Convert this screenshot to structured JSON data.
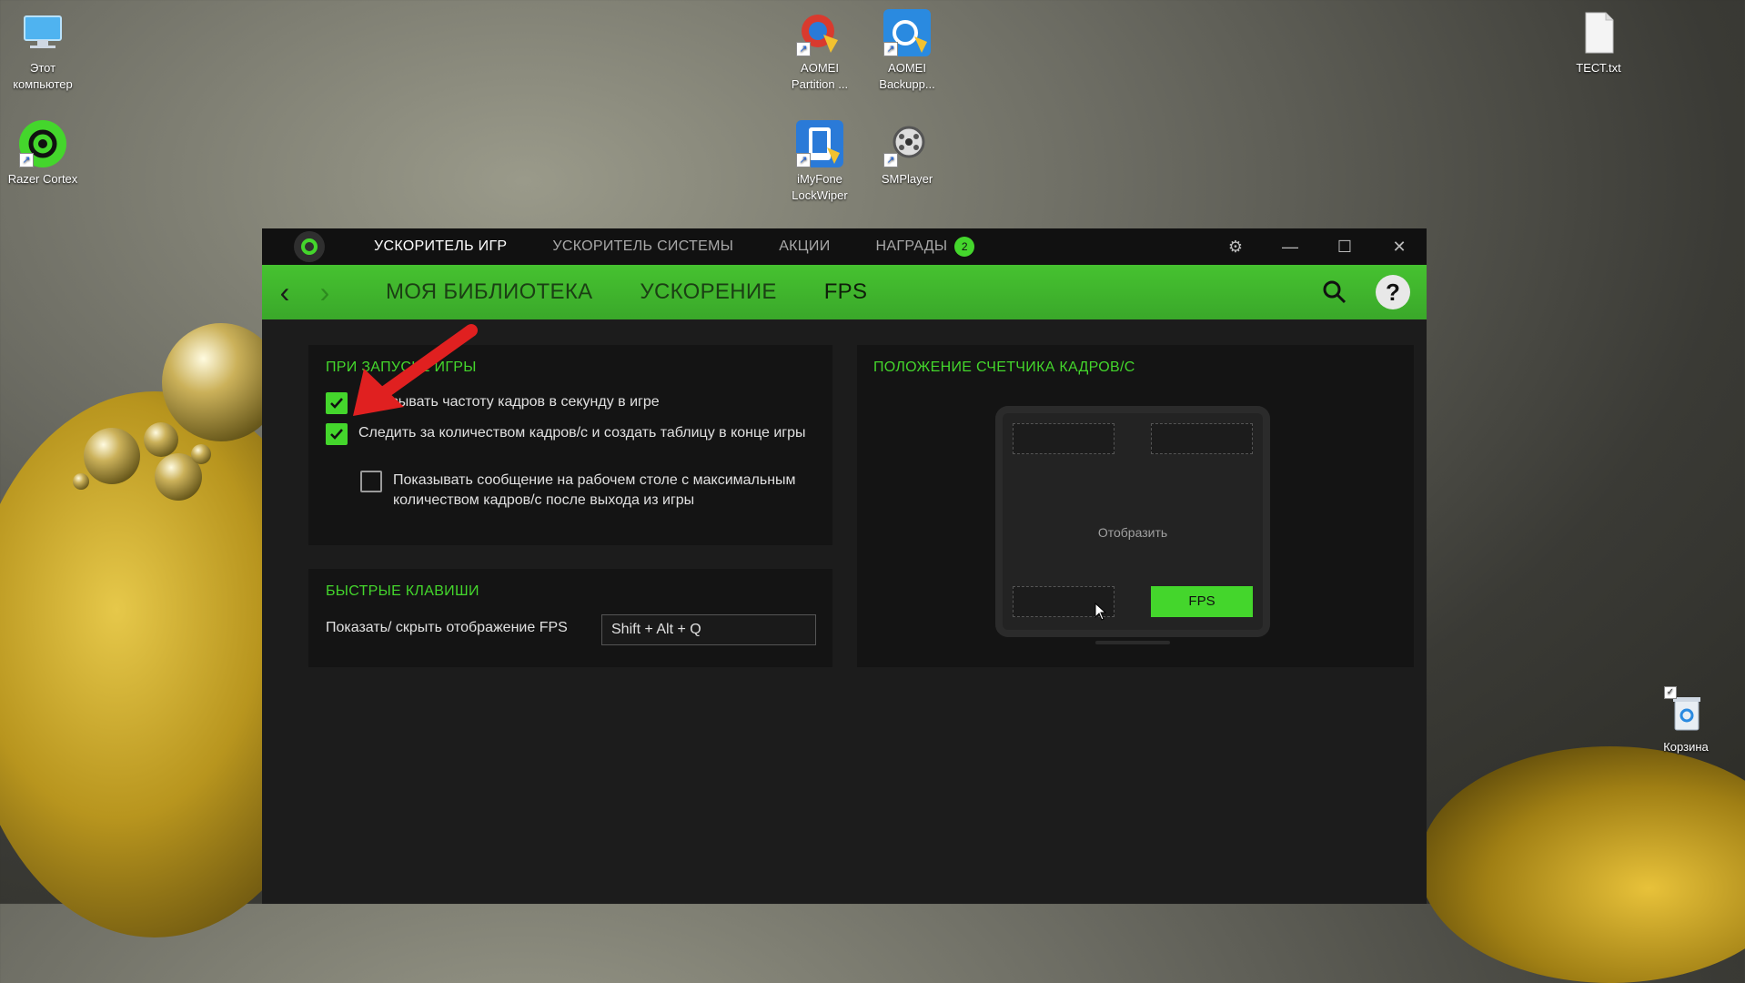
{
  "desktop": {
    "icons": [
      {
        "label_line1": "Этот",
        "label_line2": "компьютер",
        "icon": "computer-icon"
      },
      {
        "label_line1": "Razer Cortex",
        "label_line2": "",
        "icon": "razer-cortex-icon"
      },
      {
        "label_line1": "AOMEI",
        "label_line2": "Partition ...",
        "icon": "aomei-partition-icon"
      },
      {
        "label_line1": "AOMEI",
        "label_line2": "Backupp...",
        "icon": "aomei-backupper-icon"
      },
      {
        "label_line1": "iMyFone",
        "label_line2": "LockWiper",
        "icon": "imyfone-icon"
      },
      {
        "label_line1": "SMPlayer",
        "label_line2": "",
        "icon": "smplayer-icon"
      },
      {
        "label_line1": "ТЕСТ.txt",
        "label_line2": "",
        "icon": "text-file-icon"
      },
      {
        "label_line1": "Корзина",
        "label_line2": "",
        "icon": "recycle-bin-icon"
      }
    ]
  },
  "app": {
    "top_tabs": [
      {
        "label": "УСКОРИТЕЛЬ ИГР",
        "active": true
      },
      {
        "label": "УСКОРИТЕЛЬ СИСТЕМЫ",
        "active": false
      },
      {
        "label": "АКЦИИ",
        "active": false
      },
      {
        "label": "НАГРАДЫ",
        "active": false
      }
    ],
    "rewards_badge": "2",
    "sub_tabs": [
      {
        "label": "МОЯ БИБЛИОТЕКА",
        "active": false
      },
      {
        "label": "УСКОРЕНИЕ",
        "active": false
      },
      {
        "label": "FPS",
        "active": true
      }
    ],
    "help_label": "?",
    "launch_panel": {
      "title": "ПРИ ЗАПУСКЕ ИГРЫ",
      "options": [
        {
          "label": "Показывать частоту кадров в секунду в игре",
          "checked": true
        },
        {
          "label": "Следить за количеством кадров/с и создать таблицу в конце игры",
          "checked": true
        },
        {
          "label": "Показывать сообщение на рабочем столе с максимальным количеством кадров/с после выхода из игры",
          "checked": false
        }
      ]
    },
    "hotkeys_panel": {
      "title": "БЫСТРЫЕ КЛАВИШИ",
      "label": "Показать/ скрыть отображение FPS",
      "value": "Shift + Alt + Q"
    },
    "position_panel": {
      "title": "ПОЛОЖЕНИЕ СЧЕТЧИКА КАДРОВ/С",
      "center_label": "Отобразить",
      "active_slot_label": "FPS",
      "active_slot": "bottom-right"
    }
  },
  "colors": {
    "accent": "#44d62c",
    "titlebar": "#111111",
    "window_bg": "#1c1c1c",
    "panel_bg": "#141414"
  }
}
